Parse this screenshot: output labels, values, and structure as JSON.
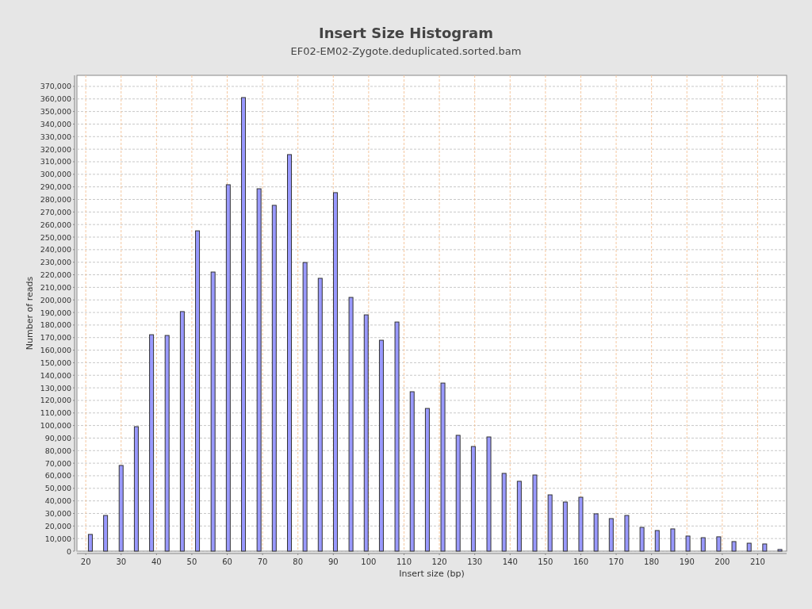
{
  "chart": {
    "subtitle": "EF02-EM02-Zygote.deduplicated.sorted.bam",
    "chart_data": {
      "type": "bar",
      "title": "Insert Size Histogram",
      "xlabel": "Insert size (bp)",
      "ylabel": "Number of reads",
      "x": [
        21.3,
        25.6,
        30.0,
        34.3,
        38.6,
        43.0,
        47.3,
        51.6,
        56.0,
        60.3,
        64.6,
        69.0,
        73.3,
        77.6,
        82.0,
        86.3,
        90.6,
        95.0,
        99.3,
        103.6,
        108.0,
        112.3,
        116.6,
        121.0,
        125.3,
        129.6,
        134.0,
        138.3,
        142.6,
        147.0,
        151.3,
        155.6,
        160.0,
        164.3,
        168.6,
        173.0,
        177.3,
        181.6,
        186.0,
        190.3,
        194.6,
        199.0,
        203.3,
        207.6,
        212.0,
        216.3
      ],
      "grid": true,
      "series": [
        {
          "color": "#9999ff",
          "values": [
            13300,
            28400,
            68200,
            99100,
            172300,
            171700,
            190700,
            255000,
            222200,
            291700,
            361100,
            288500,
            275300,
            315700,
            229800,
            217200,
            285400,
            202000,
            188100,
            167900,
            182400,
            126900,
            113600,
            133800,
            92200,
            83300,
            90900,
            61900,
            55600,
            60600,
            44800,
            39100,
            42900,
            29700,
            25900,
            28400,
            18900,
            16400,
            17700,
            12000,
            10700,
            11400,
            7600,
            6300,
            5700,
            1300
          ]
        }
      ],
      "xlim": [
        17.5,
        218.2
      ],
      "ylim": [
        0,
        378800
      ],
      "xticks": [
        20,
        30,
        40,
        50,
        60,
        70,
        80,
        90,
        100,
        110,
        120,
        130,
        140,
        150,
        160,
        170,
        180,
        190,
        200,
        210
      ],
      "yticks": [
        {
          "value": 0,
          "label": "0"
        },
        {
          "value": 10000,
          "label": "10,000"
        },
        {
          "value": 20000,
          "label": "20,000"
        },
        {
          "value": 30000,
          "label": "30,000"
        },
        {
          "value": 40000,
          "label": "40,000"
        },
        {
          "value": 50000,
          "label": "50,000"
        },
        {
          "value": 60000,
          "label": "60,000"
        },
        {
          "value": 70000,
          "label": "70,000"
        },
        {
          "value": 80000,
          "label": "80,000"
        },
        {
          "value": 90000,
          "label": "90,000"
        },
        {
          "value": 100000,
          "label": "100,000"
        },
        {
          "value": 110000,
          "label": "110,000"
        },
        {
          "value": 120000,
          "label": "120,000"
        },
        {
          "value": 130000,
          "label": "130,000"
        },
        {
          "value": 140000,
          "label": "140,000"
        },
        {
          "value": 150000,
          "label": "150,000"
        },
        {
          "value": 160000,
          "label": "160,000"
        },
        {
          "value": 170000,
          "label": "170,000"
        },
        {
          "value": 180000,
          "label": "180,000"
        },
        {
          "value": 190000,
          "label": "190,000"
        },
        {
          "value": 200000,
          "label": "200,000"
        },
        {
          "value": 210000,
          "label": "210,000"
        },
        {
          "value": 220000,
          "label": "220,000"
        },
        {
          "value": 230000,
          "label": "230,000"
        },
        {
          "value": 240000,
          "label": "240,000"
        },
        {
          "value": 250000,
          "label": "250,000"
        },
        {
          "value": 260000,
          "label": "260,000"
        },
        {
          "value": 270000,
          "label": "270,000"
        },
        {
          "value": 280000,
          "label": "280,000"
        },
        {
          "value": 290000,
          "label": "290,000"
        },
        {
          "value": 300000,
          "label": "300,000"
        },
        {
          "value": 310000,
          "label": "310,000"
        },
        {
          "value": 320000,
          "label": "320,000"
        },
        {
          "value": 330000,
          "label": "330,000"
        },
        {
          "value": 340000,
          "label": "340,000"
        },
        {
          "value": 350000,
          "label": "350,000"
        },
        {
          "value": 360000,
          "label": "360,000"
        },
        {
          "value": 370000,
          "label": "370,000"
        }
      ]
    }
  }
}
